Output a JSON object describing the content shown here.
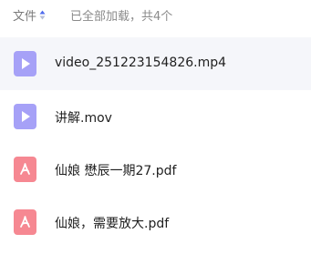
{
  "header": {
    "sort_label": "文件",
    "status_text": "已全部加载，共4个"
  },
  "files": [
    {
      "name": "video_251223154826.mp4",
      "icon": "video-file-icon",
      "color": "#a6a1f7",
      "selected": true
    },
    {
      "name": "讲解.mov",
      "icon": "video-file-icon",
      "color": "#a6a1f7",
      "selected": false
    },
    {
      "name": "仙娘 懋辰一期27.pdf",
      "icon": "pdf-file-icon",
      "color": "#f68892",
      "selected": false
    },
    {
      "name": "仙娘，需要放大.pdf",
      "icon": "pdf-file-icon",
      "color": "#f68892",
      "selected": false
    }
  ]
}
